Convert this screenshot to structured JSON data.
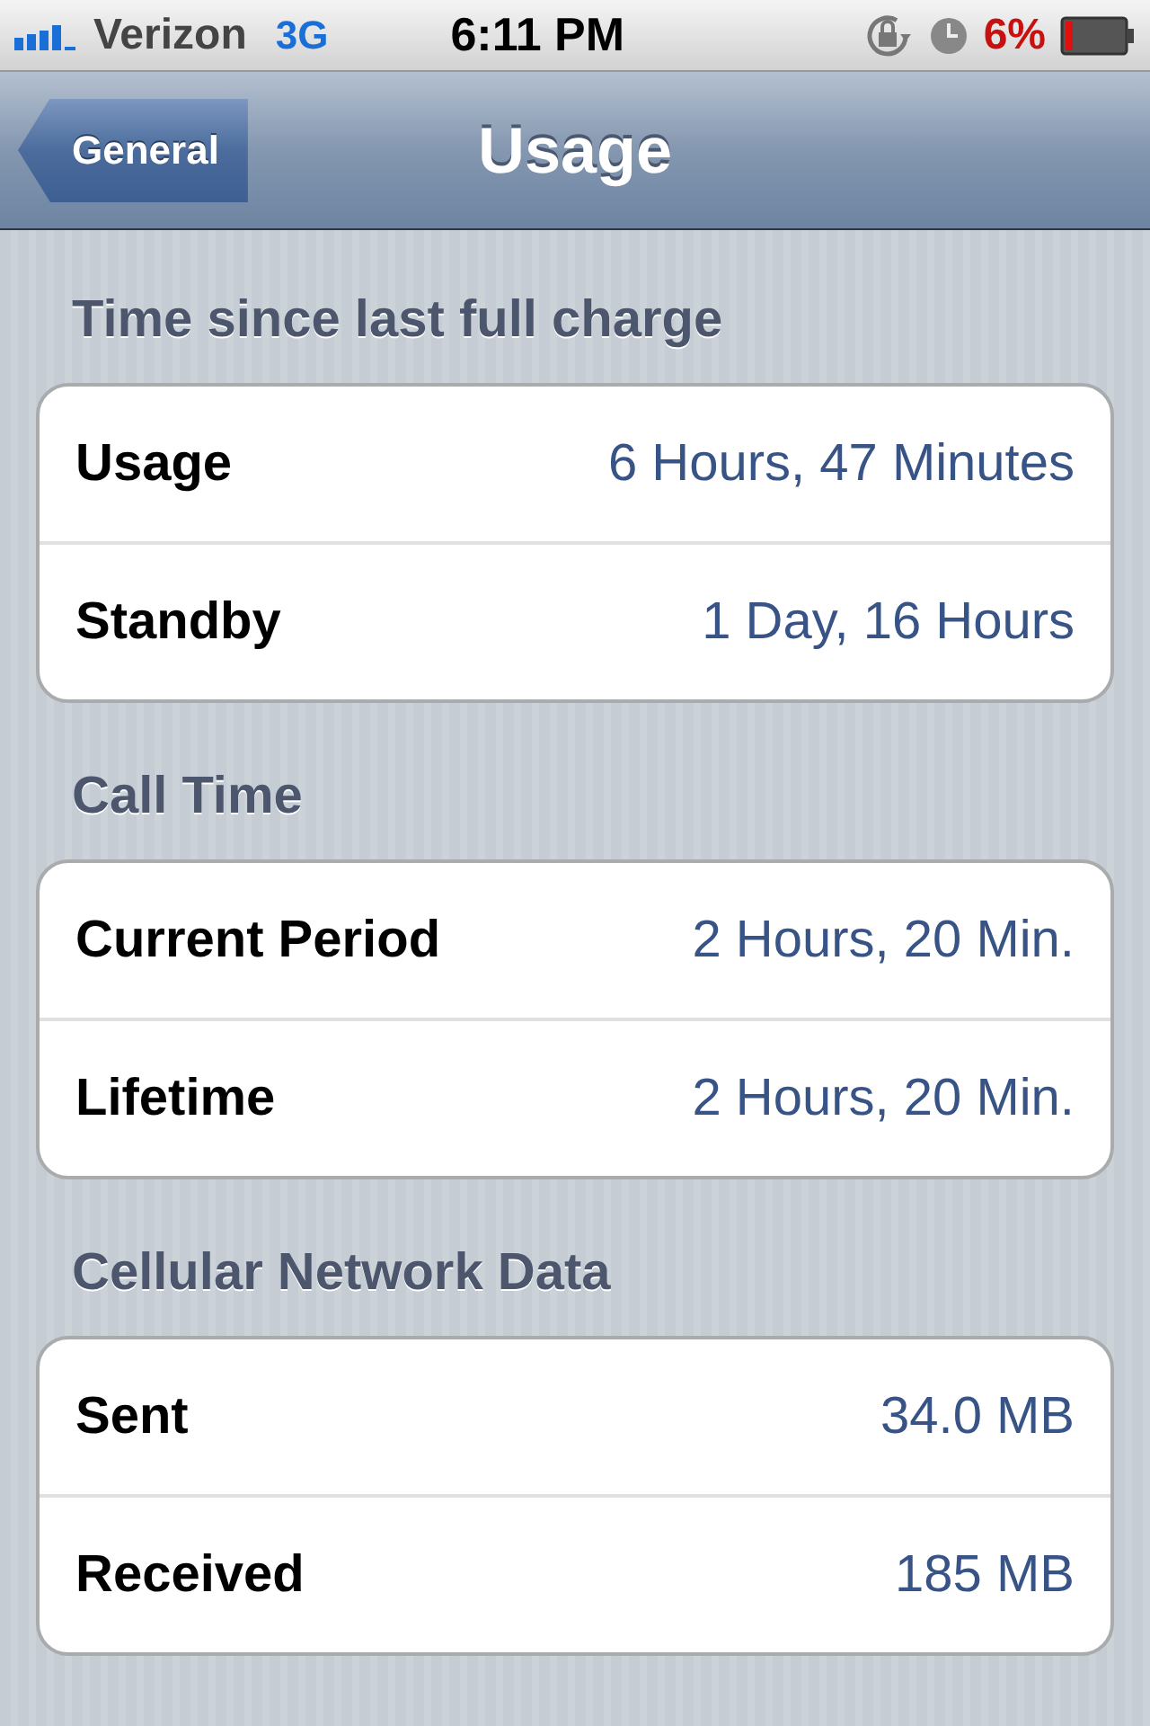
{
  "status_bar": {
    "carrier": "Verizon",
    "network": "3G",
    "time": "6:11 PM",
    "battery_percent": "6%"
  },
  "nav_bar": {
    "back_button": "General",
    "title": "Usage"
  },
  "sections": [
    {
      "header": "Time since last full charge",
      "rows": [
        {
          "label": "Usage",
          "value": "6 Hours, 47 Minutes"
        },
        {
          "label": "Standby",
          "value": "1 Day, 16 Hours"
        }
      ]
    },
    {
      "header": "Call Time",
      "rows": [
        {
          "label": "Current Period",
          "value": "2 Hours, 20 Min."
        },
        {
          "label": "Lifetime",
          "value": "2 Hours, 20 Min."
        }
      ]
    },
    {
      "header": "Cellular Network Data",
      "rows": [
        {
          "label": "Sent",
          "value": "34.0 MB"
        },
        {
          "label": "Received",
          "value": "185 MB"
        }
      ]
    }
  ]
}
